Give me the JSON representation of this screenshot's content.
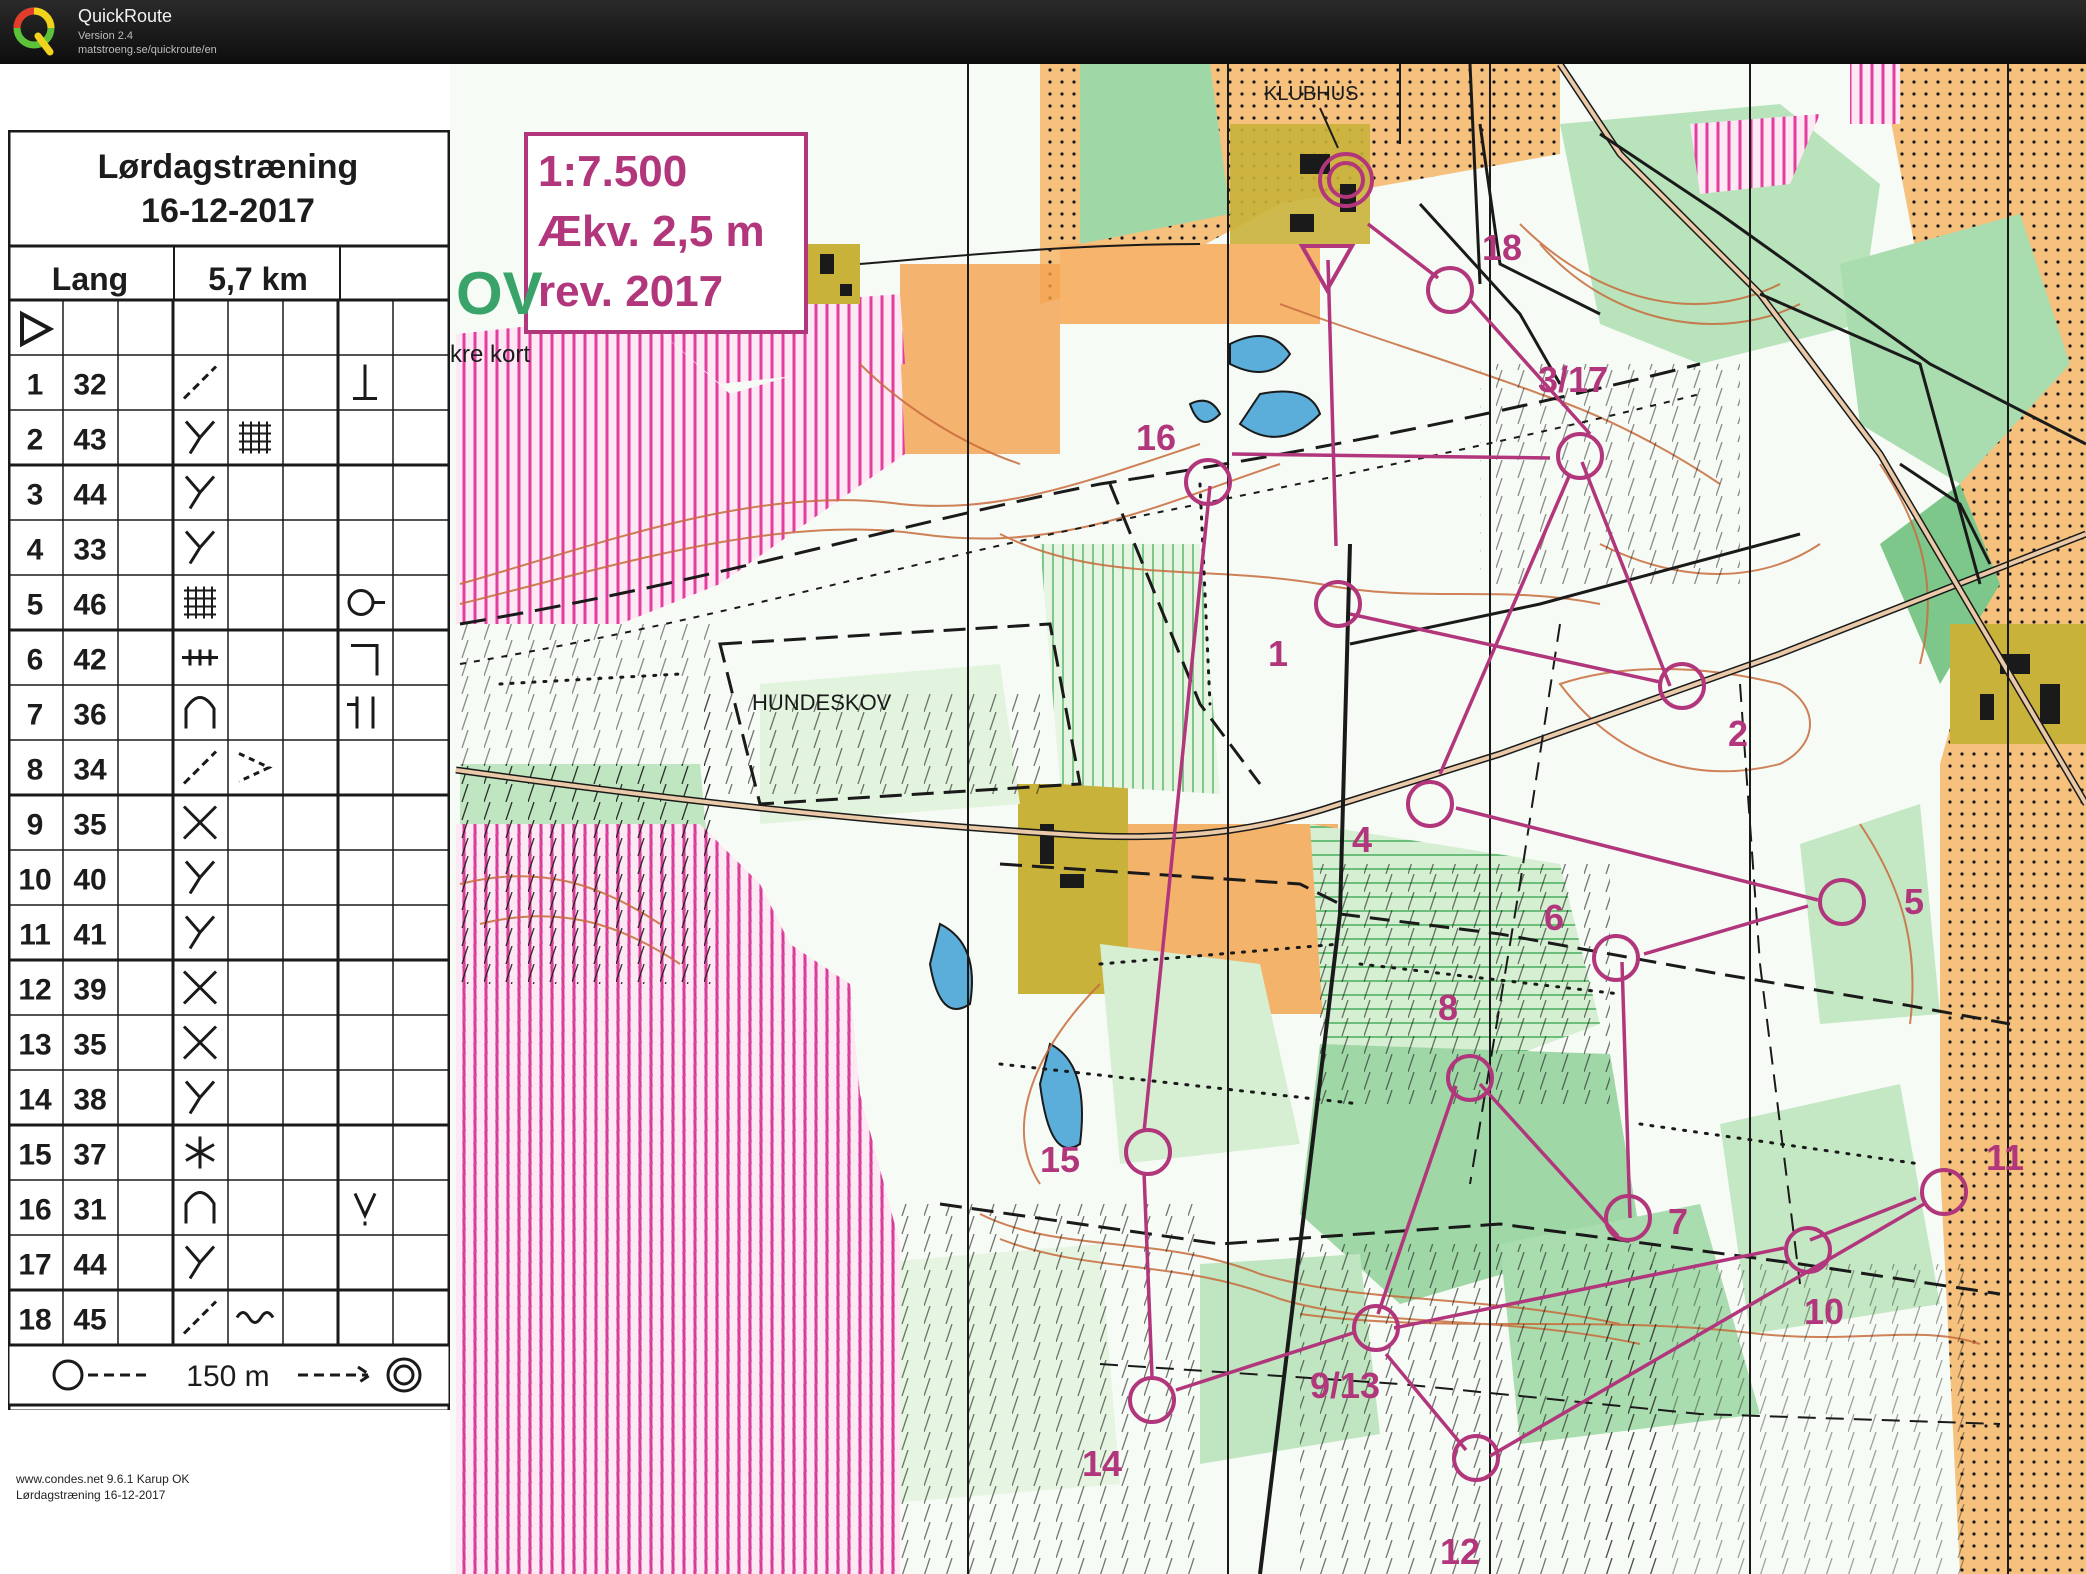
{
  "app": {
    "name": "QuickRoute",
    "version": "Version 2.4",
    "url": "matstroeng.se/quickroute/en"
  },
  "description_sheet": {
    "title": "Lørdagstræning",
    "date": "16-12-2017",
    "course": "Lang",
    "length": "5,7 km",
    "start_symbol": "start-triangle",
    "controls": [
      {
        "num": "1",
        "code": "32",
        "feature": "path-junction",
        "detail": "foot-side"
      },
      {
        "num": "2",
        "code": "43",
        "feature": "fork",
        "detail": "thicket"
      },
      {
        "num": "3",
        "code": "44",
        "feature": "fork",
        "detail": ""
      },
      {
        "num": "4",
        "code": "33",
        "feature": "fork",
        "detail": ""
      },
      {
        "num": "5",
        "code": "46",
        "feature": "thicket",
        "detail": "circle-side"
      },
      {
        "num": "6",
        "code": "42",
        "feature": "fence",
        "detail": "corner"
      },
      {
        "num": "7",
        "code": "36",
        "feature": "knoll",
        "detail": "between"
      },
      {
        "num": "8",
        "code": "34",
        "feature": "path-junction",
        "detail": "arrow-right"
      },
      {
        "num": "9",
        "code": "35",
        "feature": "crossing",
        "detail": ""
      },
      {
        "num": "10",
        "code": "40",
        "feature": "fork",
        "detail": ""
      },
      {
        "num": "11",
        "code": "41",
        "feature": "fork",
        "detail": ""
      },
      {
        "num": "12",
        "code": "39",
        "feature": "crossing",
        "detail": ""
      },
      {
        "num": "13",
        "code": "35",
        "feature": "crossing",
        "detail": ""
      },
      {
        "num": "14",
        "code": "38",
        "feature": "fork",
        "detail": ""
      },
      {
        "num": "15",
        "code": "37",
        "feature": "tree",
        "detail": ""
      },
      {
        "num": "16",
        "code": "31",
        "feature": "knoll",
        "detail": "foot-v"
      },
      {
        "num": "17",
        "code": "44",
        "feature": "fork",
        "detail": ""
      },
      {
        "num": "18",
        "code": "45",
        "feature": "path-junction",
        "detail": "wavy"
      }
    ],
    "finish": "150 m",
    "footer_1": "www.condes.net 9.6.1 Karup OK",
    "footer_2": "Lørdagstræning 16-12-2017"
  },
  "map_info": {
    "scale": "1:7.500",
    "equidistance": "Ækv. 2,5 m",
    "revision": "rev. 2017",
    "partial_text": "kre kort",
    "partial_logo": "OV"
  },
  "map_labels": {
    "clubhouse": "KLUBHUS",
    "forest": "HUNDESKOV"
  },
  "course_controls": [
    {
      "label": "1"
    },
    {
      "label": "2"
    },
    {
      "label": "3/17"
    },
    {
      "label": "4"
    },
    {
      "label": "5"
    },
    {
      "label": "6"
    },
    {
      "label": "7"
    },
    {
      "label": "8"
    },
    {
      "label": "9/13"
    },
    {
      "label": "10"
    },
    {
      "label": "11"
    },
    {
      "label": "12"
    },
    {
      "label": "14"
    },
    {
      "label": "15"
    },
    {
      "label": "16"
    },
    {
      "label": "18"
    }
  ],
  "colors": {
    "course": "#b1367b",
    "open_land": "#f4b36a",
    "forest_green": "#9fd7a6",
    "light_green": "#d6efd2",
    "olive": "#c9b23a",
    "purple_hatch": "#e23d9f",
    "contour": "#c86b3c",
    "black": "#1a1a1a"
  }
}
